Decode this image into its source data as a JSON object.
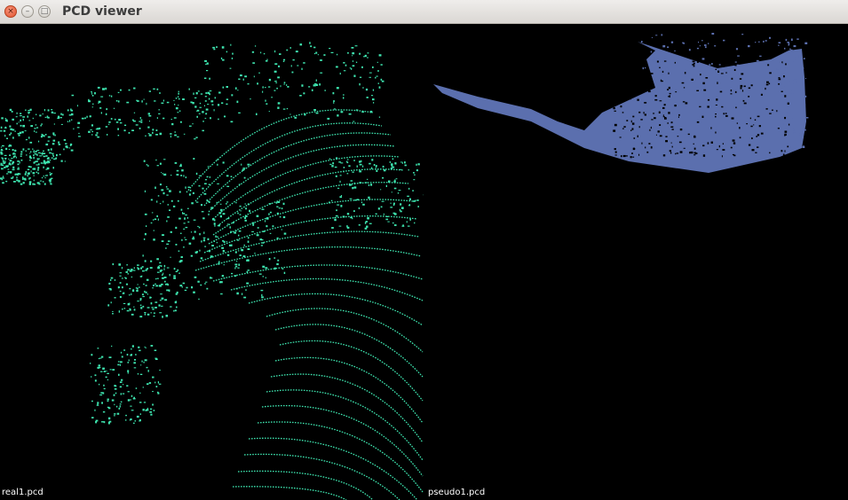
{
  "window": {
    "title": "PCD viewer",
    "controls": {
      "close": "×",
      "minimize": "–",
      "maximize": "□"
    }
  },
  "viewports": [
    {
      "label": "real1.pcd",
      "point_color": "#3ee6b0",
      "background": "#000000"
    },
    {
      "label": "pseudo1.pcd",
      "point_color": "#5b6fae",
      "background": "#000000"
    }
  ]
}
